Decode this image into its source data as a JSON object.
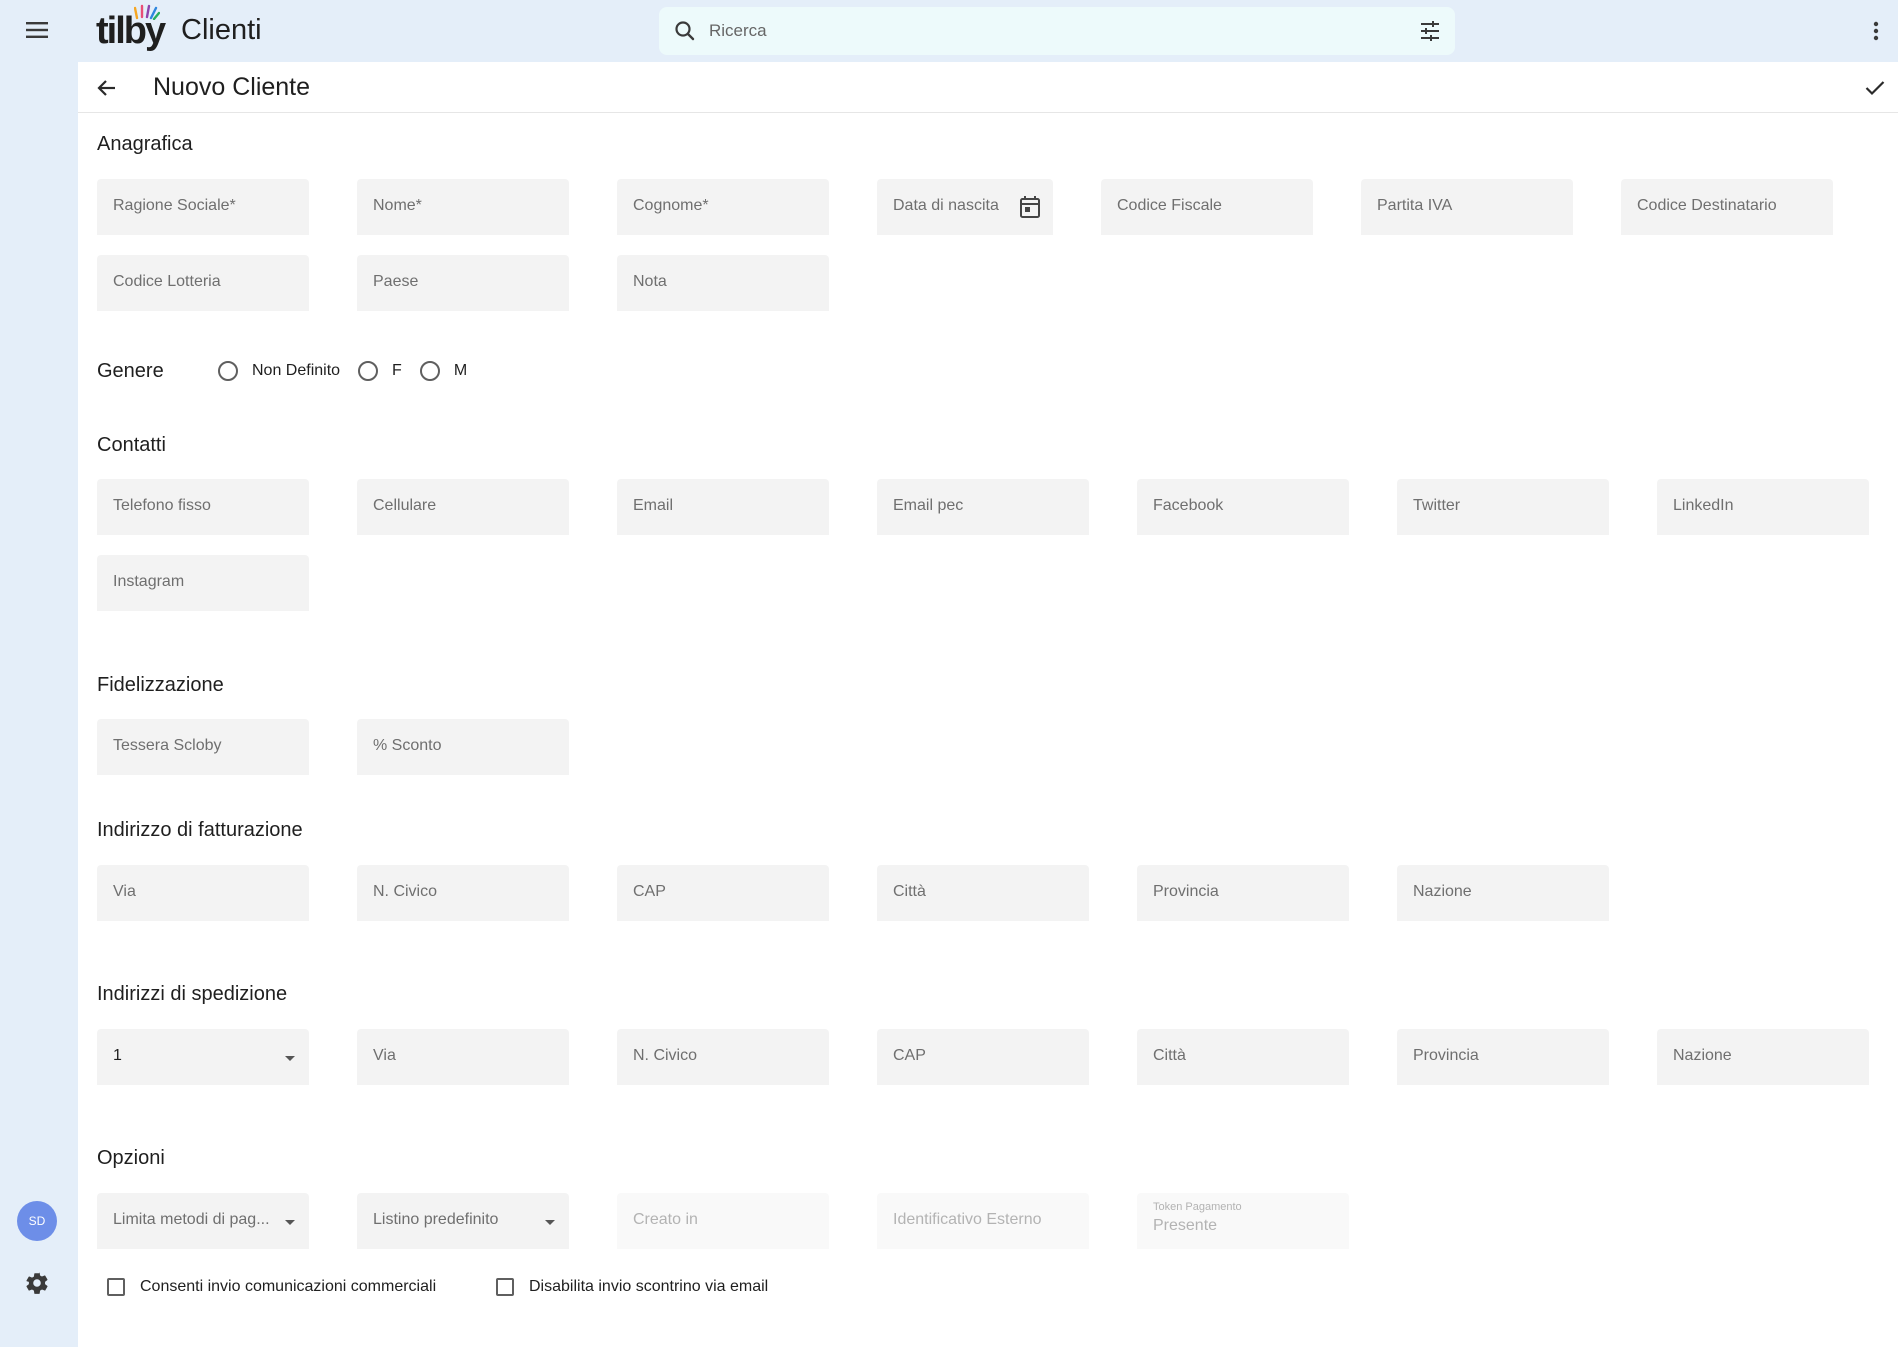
{
  "app": {
    "logo": "tilby",
    "title": "Clienti"
  },
  "search": {
    "placeholder": "Ricerca"
  },
  "rail": {
    "avatar_initials": "SD"
  },
  "header": {
    "title": "Nuovo Cliente"
  },
  "sections": {
    "anagrafica": {
      "title": "Anagrafica",
      "fields": {
        "ragione_sociale": "Ragione Sociale*",
        "nome": "Nome*",
        "cognome": "Cognome*",
        "data_nascita": "Data di nascita",
        "codice_fiscale": "Codice Fiscale",
        "partita_iva": "Partita IVA",
        "codice_destinatario": "Codice Destinatario",
        "codice_lotteria": "Codice Lotteria",
        "paese": "Paese",
        "nota": "Nota"
      }
    },
    "genere": {
      "title": "Genere",
      "options": [
        "Non Definito",
        "F",
        "M"
      ]
    },
    "contatti": {
      "title": "Contatti",
      "fields": {
        "telefono": "Telefono fisso",
        "cellulare": "Cellulare",
        "email": "Email",
        "email_pec": "Email pec",
        "facebook": "Facebook",
        "twitter": "Twitter",
        "linkedin": "LinkedIn",
        "instagram": "Instagram"
      }
    },
    "fidelizzazione": {
      "title": "Fidelizzazione",
      "fields": {
        "tessera": "Tessera Scloby",
        "sconto": "% Sconto"
      }
    },
    "fatturazione": {
      "title": "Indirizzo di fatturazione",
      "fields": {
        "via": "Via",
        "civico": "N. Civico",
        "cap": "CAP",
        "citta": "Città",
        "provincia": "Provincia",
        "nazione": "Nazione"
      }
    },
    "spedizione": {
      "title": "Indirizzi di spedizione",
      "selected_index": "1",
      "fields": {
        "via": "Via",
        "civico": "N. Civico",
        "cap": "CAP",
        "citta": "Città",
        "provincia": "Provincia",
        "nazione": "Nazione"
      }
    },
    "opzioni": {
      "title": "Opzioni",
      "fields": {
        "metodi_pagamento": "Limita metodi di pag...",
        "listino": "Listino predefinito",
        "creato_in": "Creato in",
        "id_esterno": "Identificativo Esterno",
        "token_label": "Token Pagamento",
        "token_value": "Presente"
      },
      "checkboxes": {
        "comunicazioni": "Consenti invio comunicazioni commerciali",
        "scontrino": "Disabilita invio scontrino via email"
      }
    }
  },
  "colors": {
    "background": "#e4eef9",
    "search_bg": "#edfafb",
    "field_bg": "#f3f3f3",
    "avatar": "#6d8ee8"
  }
}
